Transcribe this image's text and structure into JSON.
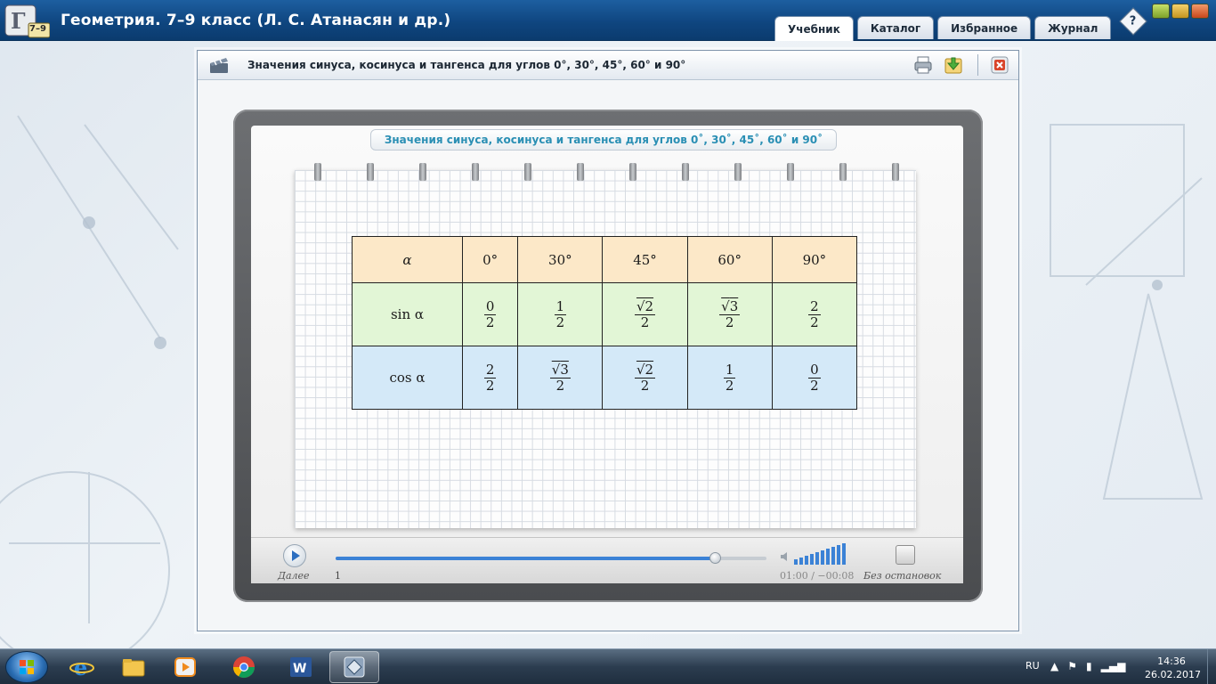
{
  "app": {
    "title": "Геометрия. 7–9 класс (Л. С. Атанасян и др.)",
    "logo_text": "7–9",
    "tabs": [
      "Учебник",
      "Каталог",
      "Избранное",
      "Журнал"
    ],
    "active_tab": "Учебник",
    "help_label": "?"
  },
  "dialog": {
    "title": "Значения синуса, косинуса и тангенса для углов 0°, 30°, 45°, 60° и 90°"
  },
  "board": {
    "title": "Значения синуса, косинуса и тангенса для углов 0˚, 30˚, 45˚, 60˚ и 90˚"
  },
  "table": {
    "header": [
      "α",
      "0°",
      "30°",
      "45°",
      "60°",
      "90°"
    ],
    "sin_label": "sin α",
    "cos_label": "cos α",
    "sin": [
      {
        "num": "0",
        "den": "2"
      },
      {
        "num": "1",
        "den": "2"
      },
      {
        "num": "2",
        "den": "2",
        "sqrt": true
      },
      {
        "num": "3",
        "den": "2",
        "sqrt": true
      },
      {
        "num": "2",
        "den": "2"
      }
    ],
    "cos": [
      {
        "num": "2",
        "den": "2"
      },
      {
        "num": "3",
        "den": "2",
        "sqrt": true
      },
      {
        "num": "2",
        "den": "2",
        "sqrt": true
      },
      {
        "num": "1",
        "den": "2"
      },
      {
        "num": "0",
        "den": "2"
      }
    ]
  },
  "player": {
    "next_label": "Далее",
    "page": "1",
    "time": "01:00  /  −00:08",
    "progress": 0.88,
    "volume_level": 10,
    "nonstop_label": "Без остановок"
  },
  "taskbar": {
    "lang": "RU",
    "time": "14:36",
    "date": "26.02.2017"
  },
  "colors": {
    "header_blue": "#0f4680",
    "row_head": "#fce8c8",
    "row_sin": "#e2f6d6",
    "row_cos": "#d4e9f8",
    "board_title": "#2a8fb4"
  }
}
